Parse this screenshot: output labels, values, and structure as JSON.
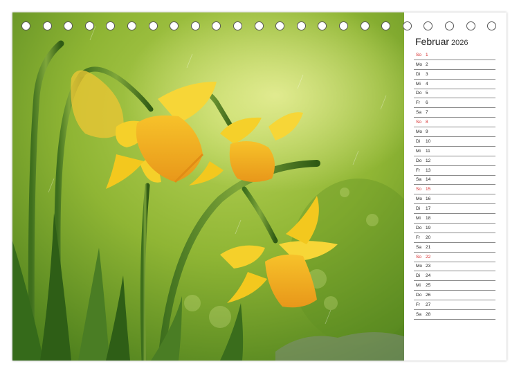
{
  "calendar": {
    "month": "Februar",
    "year": "2026",
    "days": [
      {
        "wd": "So",
        "d": "1",
        "sunday": true
      },
      {
        "wd": "Mo",
        "d": "2"
      },
      {
        "wd": "Di",
        "d": "3"
      },
      {
        "wd": "Mi",
        "d": "4"
      },
      {
        "wd": "Do",
        "d": "5"
      },
      {
        "wd": "Fr",
        "d": "6"
      },
      {
        "wd": "Sa",
        "d": "7"
      },
      {
        "wd": "So",
        "d": "8",
        "sunday": true
      },
      {
        "wd": "Mo",
        "d": "9"
      },
      {
        "wd": "Di",
        "d": "10"
      },
      {
        "wd": "Mi",
        "d": "11"
      },
      {
        "wd": "Do",
        "d": "12"
      },
      {
        "wd": "Fr",
        "d": "13"
      },
      {
        "wd": "Sa",
        "d": "14"
      },
      {
        "wd": "So",
        "d": "15",
        "sunday": true
      },
      {
        "wd": "Mo",
        "d": "16"
      },
      {
        "wd": "Di",
        "d": "17"
      },
      {
        "wd": "Mi",
        "d": "18"
      },
      {
        "wd": "Do",
        "d": "19"
      },
      {
        "wd": "Fr",
        "d": "20"
      },
      {
        "wd": "Sa",
        "d": "21"
      },
      {
        "wd": "So",
        "d": "22",
        "sunday": true
      },
      {
        "wd": "Mo",
        "d": "23"
      },
      {
        "wd": "Di",
        "d": "24"
      },
      {
        "wd": "Mi",
        "d": "25"
      },
      {
        "wd": "Do",
        "d": "26"
      },
      {
        "wd": "Fr",
        "d": "27"
      },
      {
        "wd": "Sa",
        "d": "28"
      }
    ]
  },
  "binding": {
    "ring_count": 23
  },
  "colors": {
    "sunday": "#d62a2a",
    "background_green": "#8fb534",
    "flower_yellow": "#f5cc1a",
    "trumpet_orange": "#eaa51b"
  },
  "photo": {
    "subject_icon": "daffodil-icon"
  }
}
